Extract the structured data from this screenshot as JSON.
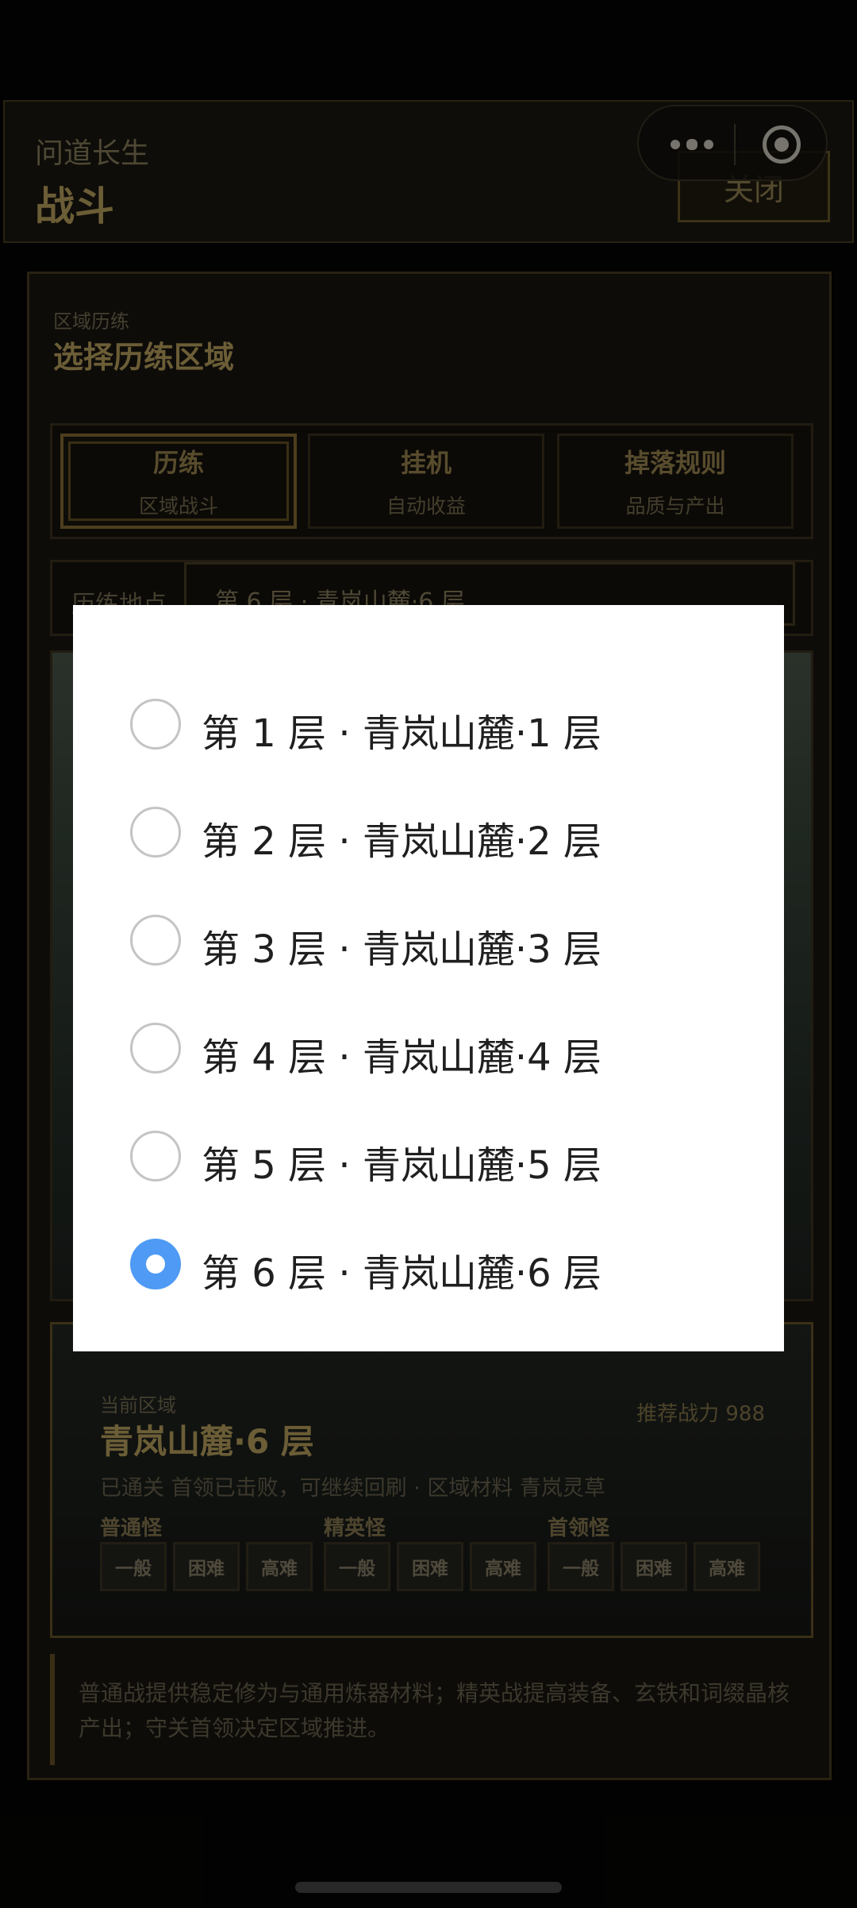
{
  "header": {
    "app_name": "问道长生",
    "page_title": "战斗",
    "close_label": "关闭"
  },
  "panel": {
    "subtitle": "区域历练",
    "title": "选择历练区域",
    "tabs": [
      {
        "title": "历练",
        "desc": "区域战斗",
        "active": true
      },
      {
        "title": "挂机",
        "desc": "自动收益",
        "active": false
      },
      {
        "title": "掉落规则",
        "desc": "品质与产出",
        "active": false
      }
    ],
    "location_label": "历练地点",
    "location_value": "第 6 层 · 青岚山麓·6 层"
  },
  "area": {
    "subtitle": "当前区域",
    "name": "青岚山麓·6 层",
    "power": "推荐战力 988",
    "status": "已通关 首领已击败，可继续回刷 · 区域材料 青岚灵草",
    "groups": [
      {
        "label": "普通怪",
        "difficulties": [
          "一般",
          "困难",
          "高难"
        ]
      },
      {
        "label": "精英怪",
        "difficulties": [
          "一般",
          "困难",
          "高难"
        ]
      },
      {
        "label": "首领怪",
        "difficulties": [
          "一般",
          "困难",
          "高难"
        ]
      }
    ]
  },
  "tip": "普通战提供稳定修为与通用炼器材料；精英战提高装备、玄铁和词缀晶核产出；守关首领决定区域推进。",
  "picker": {
    "selected_index": 5,
    "options": [
      "第 1 层 · 青岚山麓·1 层",
      "第 2 层 · 青岚山麓·2 层",
      "第 3 层 · 青岚山麓·3 层",
      "第 4 层 · 青岚山麓·4 层",
      "第 5 层 · 青岚山麓·5 层",
      "第 6 层 · 青岚山麓·6 层"
    ]
  },
  "colors": {
    "accent_gold": "#c4aa63",
    "radio_selected": "#4e9af4",
    "background": "#060504"
  }
}
